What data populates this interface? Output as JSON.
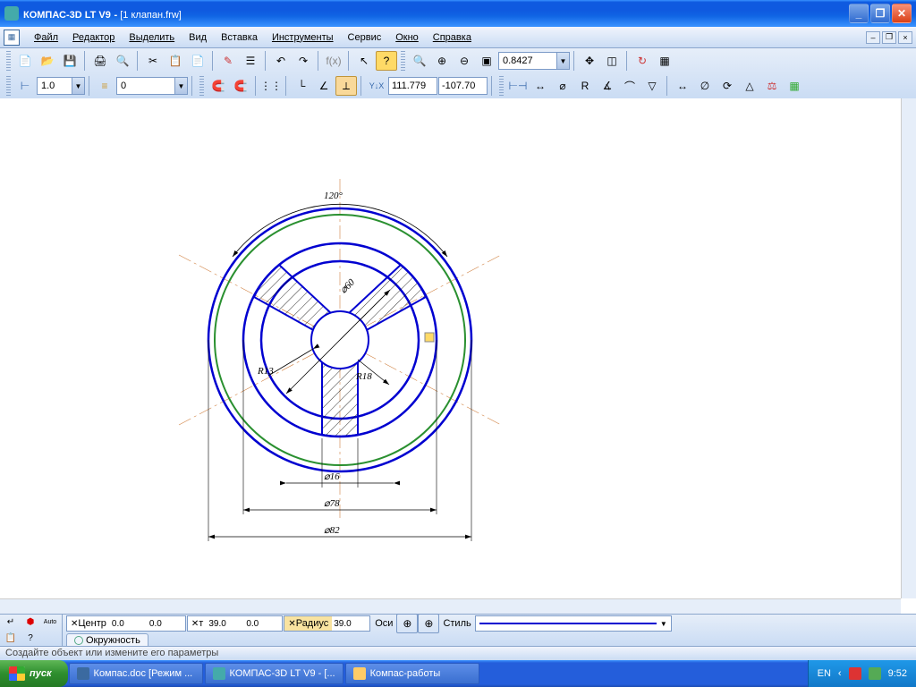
{
  "window": {
    "app": "КОМПАС-3D LT V9",
    "doc": "[1 клапан.frw]"
  },
  "menu": {
    "file": "Файл",
    "edit": "Редактор",
    "select": "Выделить",
    "view": "Вид",
    "insert": "Вставка",
    "tools": "Инструменты",
    "service": "Сервис",
    "window": "Окно",
    "help": "Справка"
  },
  "toolbar": {
    "zoom": "0.8427",
    "step": "1.0",
    "layer": "0",
    "coord_x": "111.779",
    "coord_y": "-107.70"
  },
  "drawing": {
    "angle": "120°",
    "d60": "⌀60",
    "r13": "R13",
    "r18": "R18",
    "d16": "⌀16",
    "d78": "⌀78",
    "d82": "⌀82"
  },
  "props": {
    "center_label": "Центр",
    "center_x": "0.0",
    "center_y": "0.0",
    "tx_label": "т",
    "tx": "39.0",
    "ty": "0.0",
    "radius_label": "Радиус",
    "radius": "39.0",
    "axes": "Оси",
    "style": "Стиль",
    "tab": "Окружность"
  },
  "status": "Создайте объект или измените его параметры",
  "taskbar": {
    "start": "пуск",
    "task1": "Компас.doc [Режим ...",
    "task2": "КОМПАС-3D LT V9 - [...",
    "task3": "Компас-работы",
    "lang": "EN",
    "time": "9:52"
  }
}
